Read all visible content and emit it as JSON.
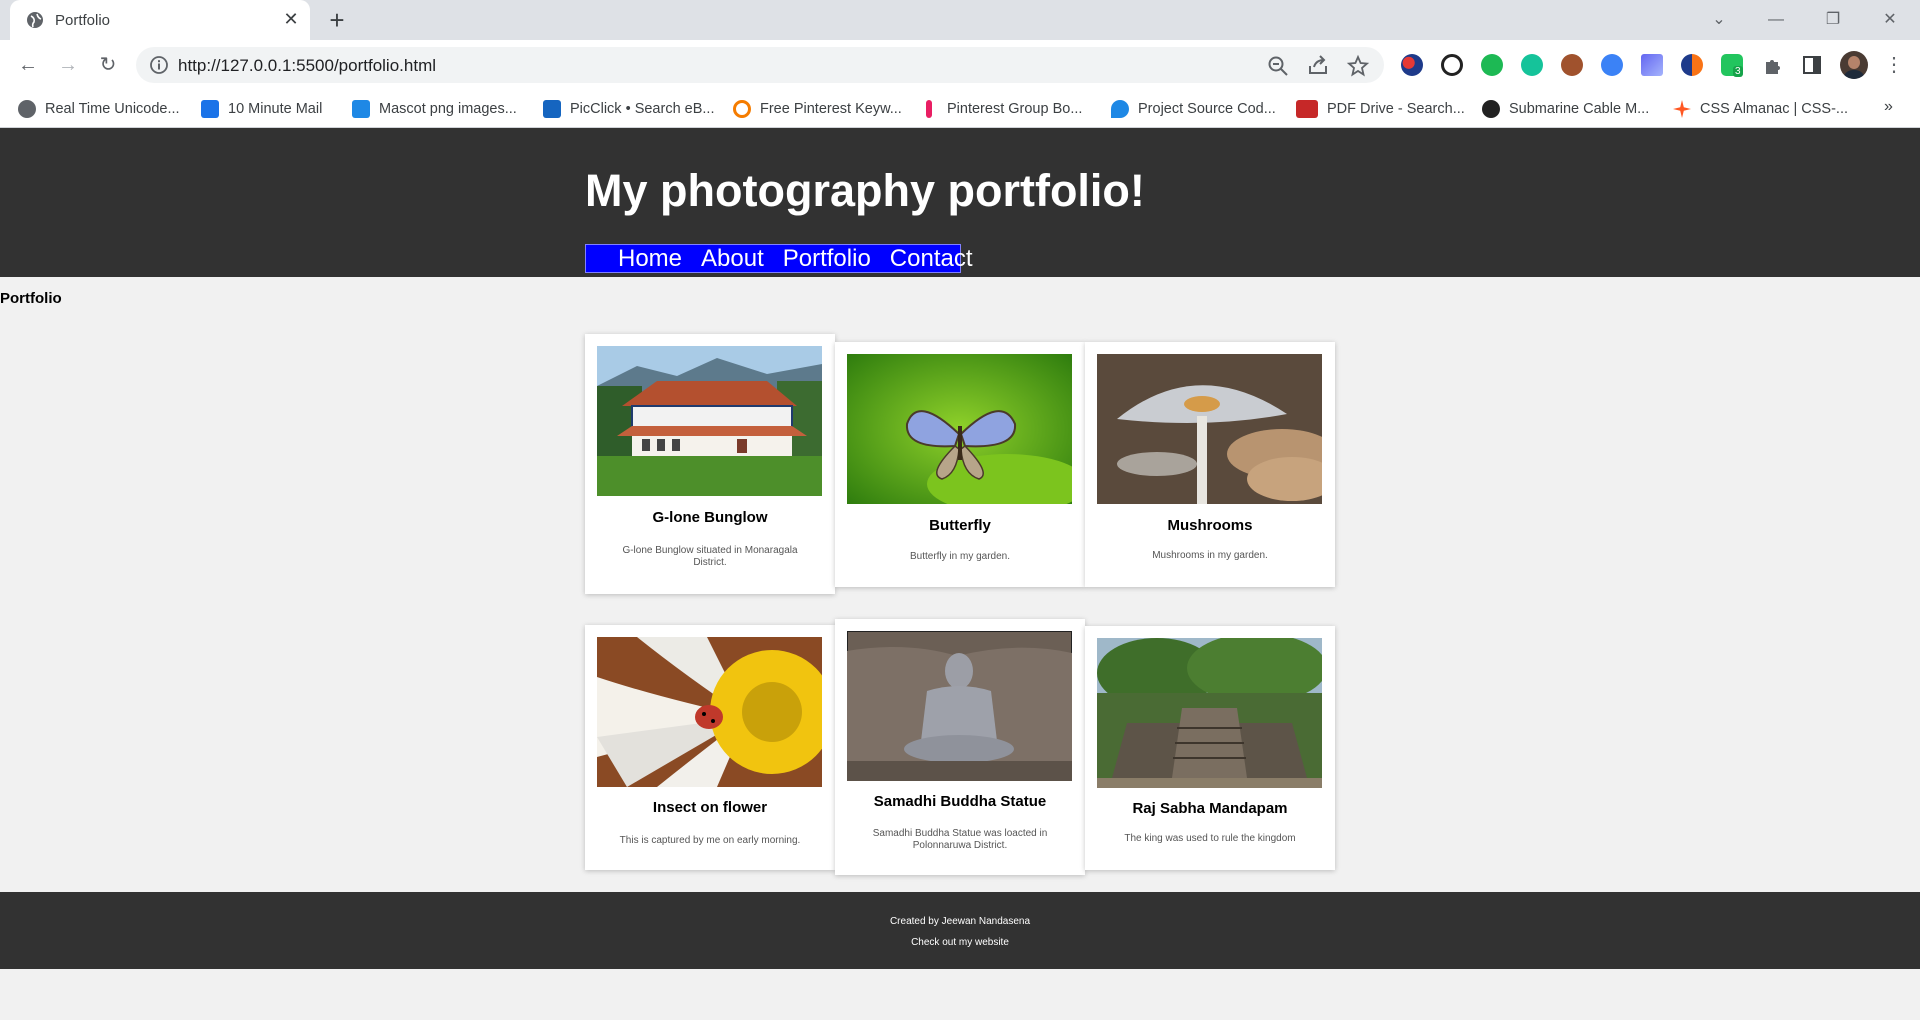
{
  "browser": {
    "tab_title": "Portfolio",
    "url": "http://127.0.0.1:5500/portfolio.html",
    "bookmarks": [
      "Real Time Unicode...",
      "10 Minute Mail",
      "Mascot png images...",
      "PicClick • Search eB...",
      "Free Pinterest Keyw...",
      "Pinterest Group Bo...",
      "Project Source Cod...",
      "PDF Drive - Search...",
      "Submarine Cable M...",
      "CSS Almanac | CSS-..."
    ],
    "bookmarks_overflow": "»",
    "extension_badge": "3"
  },
  "site": {
    "title": "My photography portfolio!",
    "nav": [
      "Home",
      "About",
      "Portfolio",
      "Contact"
    ],
    "page_label": "Portfolio",
    "cards": [
      {
        "title": "G-lone Bunglow",
        "desc": "G-lone Bunglow situated in Monaragala District."
      },
      {
        "title": "Butterfly",
        "desc": "Butterfly in my garden."
      },
      {
        "title": "Mushrooms",
        "desc": "Mushrooms in my garden."
      },
      {
        "title": "Insect on flower",
        "desc": "This is captured by me on early morning."
      },
      {
        "title": "Samadhi Buddha Statue",
        "desc": "Samadhi Buddha Statue was loacted in Polonnaruwa District."
      },
      {
        "title": "Raj Sabha Mandapam",
        "desc": "The king was used to rule the kingdom"
      }
    ],
    "footer": {
      "created": "Created by Jeewan Nandasena",
      "link": "Check out my website"
    }
  }
}
